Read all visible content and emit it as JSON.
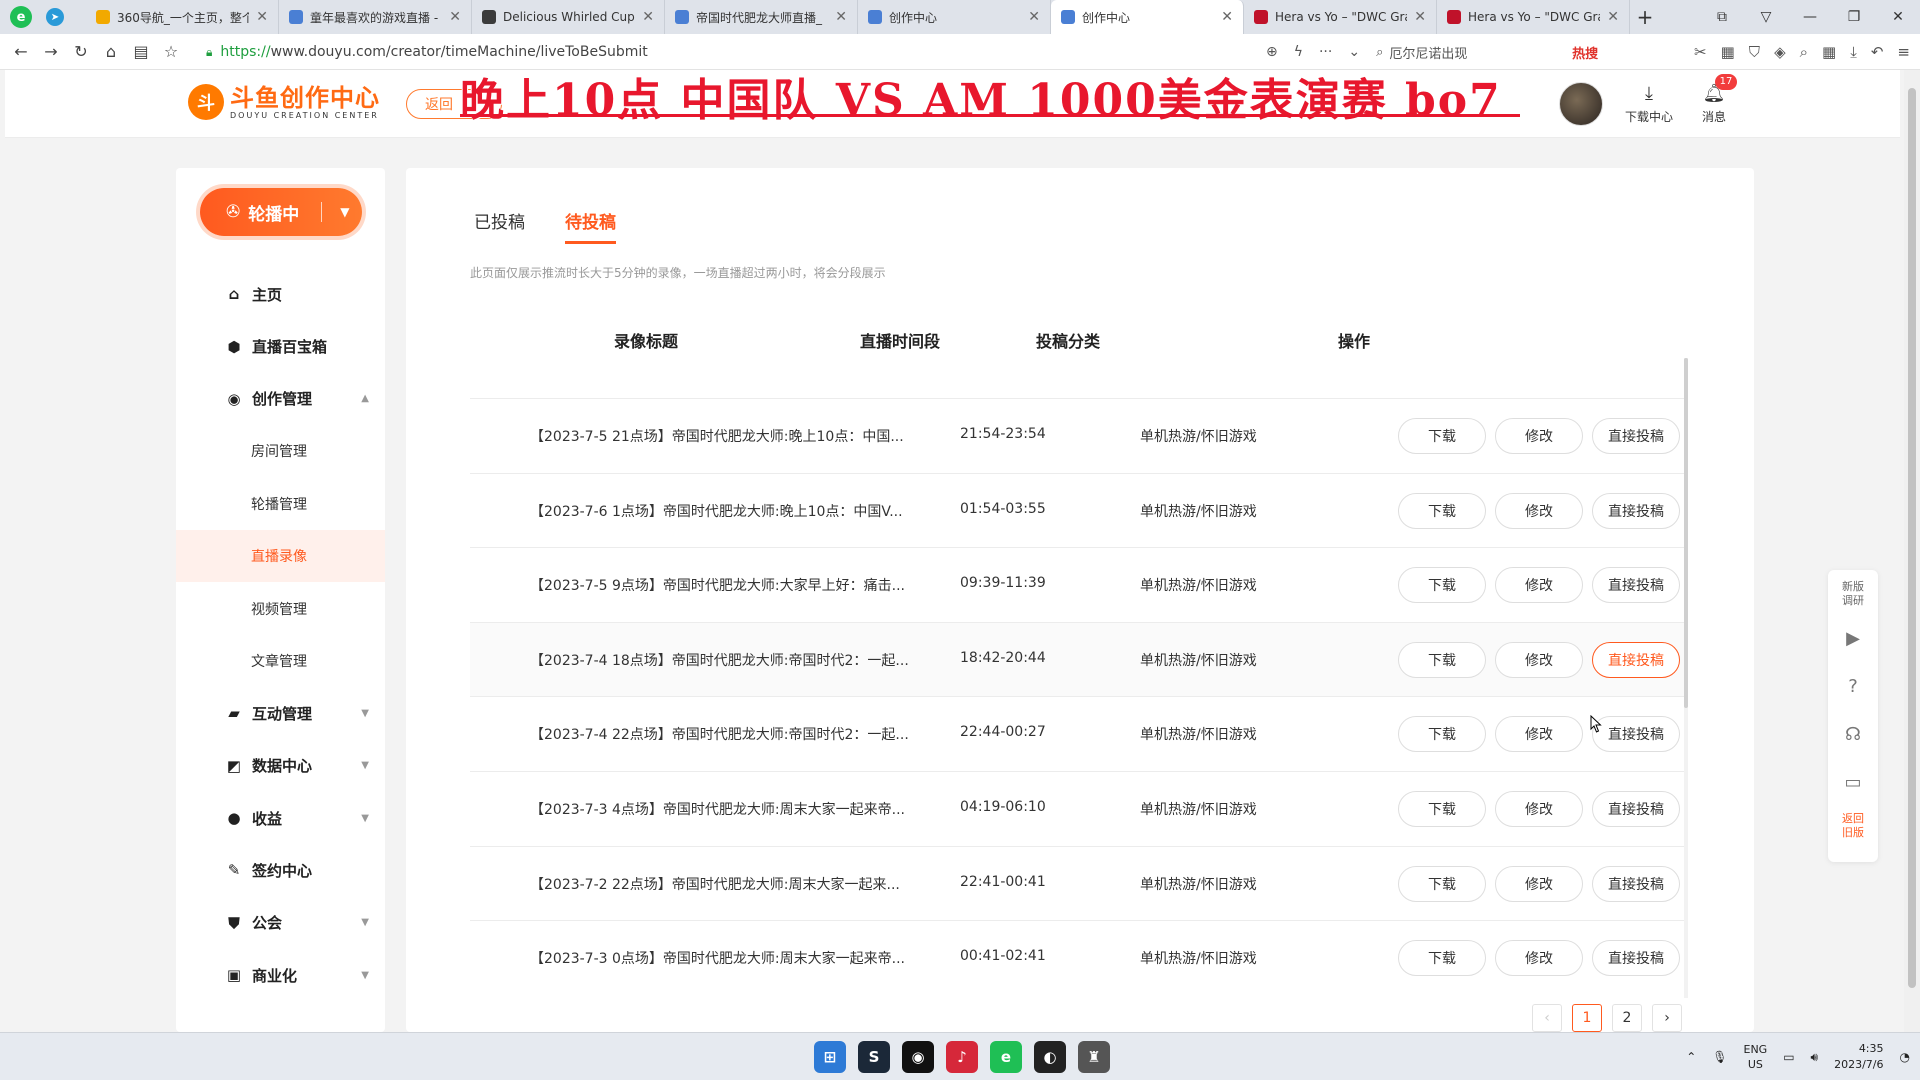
{
  "browser": {
    "tabs": [
      {
        "title": "360导航_一个主页，整个",
        "icon_color": "#f2a900",
        "icon": "360-icon"
      },
      {
        "title": "童年最喜欢的游戏直播 -",
        "icon_color": "#4a7fd4",
        "icon": "steam-icon"
      },
      {
        "title": "Delicious Whirled Cup",
        "icon_color": "#3b3b3b",
        "icon": "game-icon"
      },
      {
        "title": "帝国时代肥龙大师直播_",
        "icon_color": "#4a7fd4",
        "icon": "steam-icon"
      },
      {
        "title": "创作中心",
        "icon_color": "#4a7fd4",
        "icon": "steam-icon"
      },
      {
        "title": "创作中心",
        "icon_color": "#4a7fd4",
        "icon": "steam-icon",
        "active": true
      },
      {
        "title": "Hera vs Yo – \"DWC Gra",
        "icon_color": "#c0122a",
        "icon": "cm-icon"
      },
      {
        "title": "Hera vs Yo – \"DWC Gra",
        "icon_color": "#c0122a",
        "icon": "cm-icon"
      }
    ],
    "url_scheme": "https://",
    "url_rest": "www.douyu.com/creator/timeMachine/liveToBeSubmit",
    "search_hint": "厄尔尼诺出现",
    "hot_label": "热搜"
  },
  "header": {
    "logo_zh": "斗鱼创作中心",
    "logo_en": "DOUYU CREATION CENTER",
    "back_label": "返回",
    "overlay_text": "晚上10点  中国队 VS AM  1000美金表演赛  bo7",
    "download_label": "下载中心",
    "message_label": "消息",
    "message_badge": "17"
  },
  "sidebar": {
    "live_label": "轮播中",
    "items": [
      {
        "label": "主页",
        "icon": "home-icon",
        "glyph": "⌂",
        "type": "top"
      },
      {
        "label": "直播百宝箱",
        "icon": "toolbox-icon",
        "glyph": "⬢",
        "type": "top"
      },
      {
        "label": "创作管理",
        "icon": "bulb-icon",
        "glyph": "◉",
        "type": "top",
        "caret": "▲"
      },
      {
        "label": "房间管理",
        "type": "sub"
      },
      {
        "label": "轮播管理",
        "type": "sub"
      },
      {
        "label": "直播录像",
        "type": "sub",
        "active": true
      },
      {
        "label": "视频管理",
        "type": "sub"
      },
      {
        "label": "文章管理",
        "type": "sub"
      },
      {
        "label": "互动管理",
        "icon": "chat-icon",
        "glyph": "▰",
        "type": "top",
        "caret": "▼"
      },
      {
        "label": "数据中心",
        "icon": "chart-icon",
        "glyph": "◩",
        "type": "top",
        "caret": "▼"
      },
      {
        "label": "收益",
        "icon": "coin-icon",
        "glyph": "●",
        "type": "top",
        "caret": "▼"
      },
      {
        "label": "签约中心",
        "icon": "pen-icon",
        "glyph": "✎",
        "type": "top"
      },
      {
        "label": "公会",
        "icon": "shield-icon",
        "glyph": "⛊",
        "type": "top",
        "caret": "▼"
      },
      {
        "label": "商业化",
        "icon": "briefcase-icon",
        "glyph": "▣",
        "type": "top",
        "caret": "▼"
      }
    ]
  },
  "main": {
    "tabs": [
      {
        "label": "已投稿"
      },
      {
        "label": "待投稿",
        "active": true
      }
    ],
    "notice": "此页面仅展示推流时长大于5分钟的录像，一场直播超过两小时，将会分段展示",
    "columns": [
      "录像标题",
      "直播时间段",
      "投稿分类",
      "操作"
    ],
    "actions": {
      "download": "下载",
      "edit": "修改",
      "submit": "直接投稿"
    },
    "rows": [
      {
        "title": "【2023-7-5 21点场】帝国时代肥龙大师:晚上10点：中国...",
        "time": "21:54-23:54",
        "category": "单机热游/怀旧游戏"
      },
      {
        "title": "【2023-7-6 1点场】帝国时代肥龙大师:晚上10点：中国V...",
        "time": "01:54-03:55",
        "category": "单机热游/怀旧游戏"
      },
      {
        "title": "【2023-7-5 9点场】帝国时代肥龙大师:大家早上好：痛击...",
        "time": "09:39-11:39",
        "category": "单机热游/怀旧游戏"
      },
      {
        "title": "【2023-7-4 18点场】帝国时代肥龙大师:帝国时代2：一起...",
        "time": "18:42-20:44",
        "category": "单机热游/怀旧游戏",
        "hover": true
      },
      {
        "title": "【2023-7-4 22点场】帝国时代肥龙大师:帝国时代2：一起...",
        "time": "22:44-00:27",
        "category": "单机热游/怀旧游戏"
      },
      {
        "title": "【2023-7-3 4点场】帝国时代肥龙大师:周末大家一起来帝...",
        "time": "04:19-06:10",
        "category": "单机热游/怀旧游戏"
      },
      {
        "title": "【2023-7-2 22点场】帝国时代肥龙大师:周末大家一起来...",
        "time": "22:41-00:41",
        "category": "单机热游/怀旧游戏"
      },
      {
        "title": "【2023-7-3 0点场】帝国时代肥龙大师:周末大家一起来帝...",
        "time": "00:41-02:41",
        "category": "单机热游/怀旧游戏"
      }
    ],
    "pager": {
      "prev": "‹",
      "pages": [
        "1",
        "2"
      ],
      "current": "1",
      "next": "›"
    }
  },
  "float_bar": {
    "survey_label": "新版调研",
    "old_label": "返回旧版"
  },
  "taskbar": {
    "lang_top": "ENG",
    "lang_bottom": "US",
    "time": "4:35",
    "date": "2023/7/6"
  }
}
